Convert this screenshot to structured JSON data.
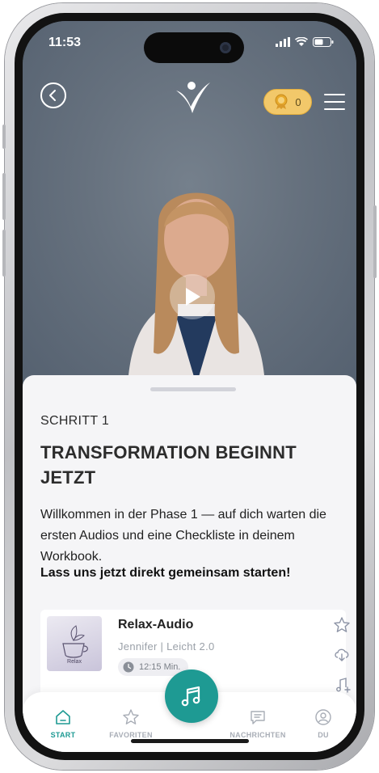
{
  "status": {
    "time": "11:53"
  },
  "header": {
    "coins": "0"
  },
  "sheet": {
    "step": "SCHRITT 1",
    "title": "TRANSFORMATION BEGINNT JETZT",
    "intro": "Willkommen in der Phase 1 — auf dich warten die ersten Audios und eine Checkliste in deinem Workbook.",
    "cta": "Lass uns jetzt direkt gemeinsam starten!"
  },
  "audio_card": {
    "thumb_label": "Relax",
    "title": "Relax-Audio",
    "subtitle": "Jennifer | Leicht 2.0",
    "duration": "12:15 Min."
  },
  "nav": {
    "start": "START",
    "favorites": "FAVORITEN",
    "messages": "NACHRICHTEN",
    "you": "DU"
  },
  "colors": {
    "accent": "#1e9a93",
    "coin": "#f2c86a"
  }
}
